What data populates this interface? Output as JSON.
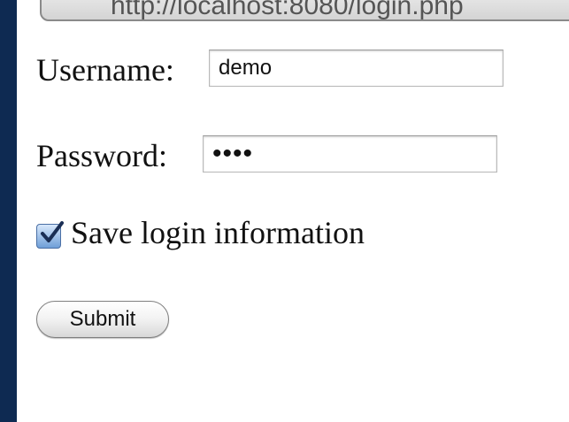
{
  "browser": {
    "url": "http://localhost:8080/login.php"
  },
  "form": {
    "username_label": "Username:",
    "username_value": "demo",
    "password_label": "Password:",
    "password_value": "demo",
    "save_login_label": "Save login information",
    "save_login_checked": true,
    "submit_label": "Submit"
  },
  "colors": {
    "left_frame": "#0e2a52",
    "checkbox_accent": "#6f9fd8"
  }
}
